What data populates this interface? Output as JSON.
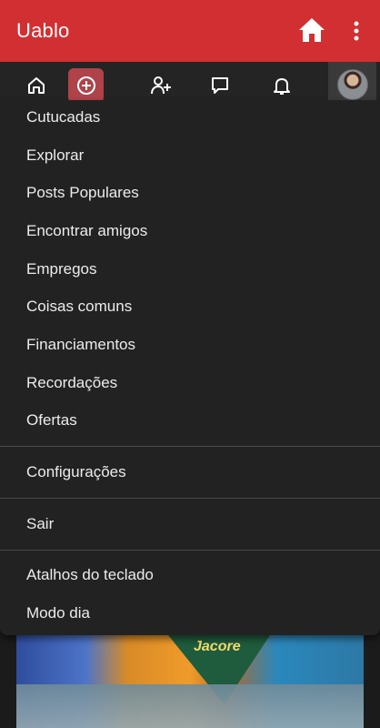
{
  "app": {
    "title": "Uablo"
  },
  "appbar": {
    "home_icon": "home-icon",
    "more_icon": "more-vert-icon"
  },
  "navbar": {
    "items": [
      {
        "icon": "home-outline-icon"
      },
      {
        "icon": "add-circle-icon",
        "accent": "#b0424a"
      },
      {
        "icon": "add-friend-icon"
      },
      {
        "icon": "message-icon"
      },
      {
        "icon": "bell-icon"
      },
      {
        "icon": "avatar"
      }
    ]
  },
  "menu": {
    "group_1": [
      "Cutucadas",
      "Explorar",
      "Posts Populares",
      "Encontrar amigos",
      "Empregos",
      "Coisas comuns",
      "Financiamentos",
      "Recordações",
      "Ofertas"
    ],
    "settings": "Configurações",
    "logout": "Sair",
    "shortcuts": "Atalhos do teclado",
    "day_mode": "Modo dia"
  },
  "background_post": {
    "label_text": "Jacore"
  },
  "colors": {
    "appbar": "#d22f33",
    "menu_bg": "#222222",
    "nav_bg": "#242424",
    "create_accent": "#b0424a"
  }
}
